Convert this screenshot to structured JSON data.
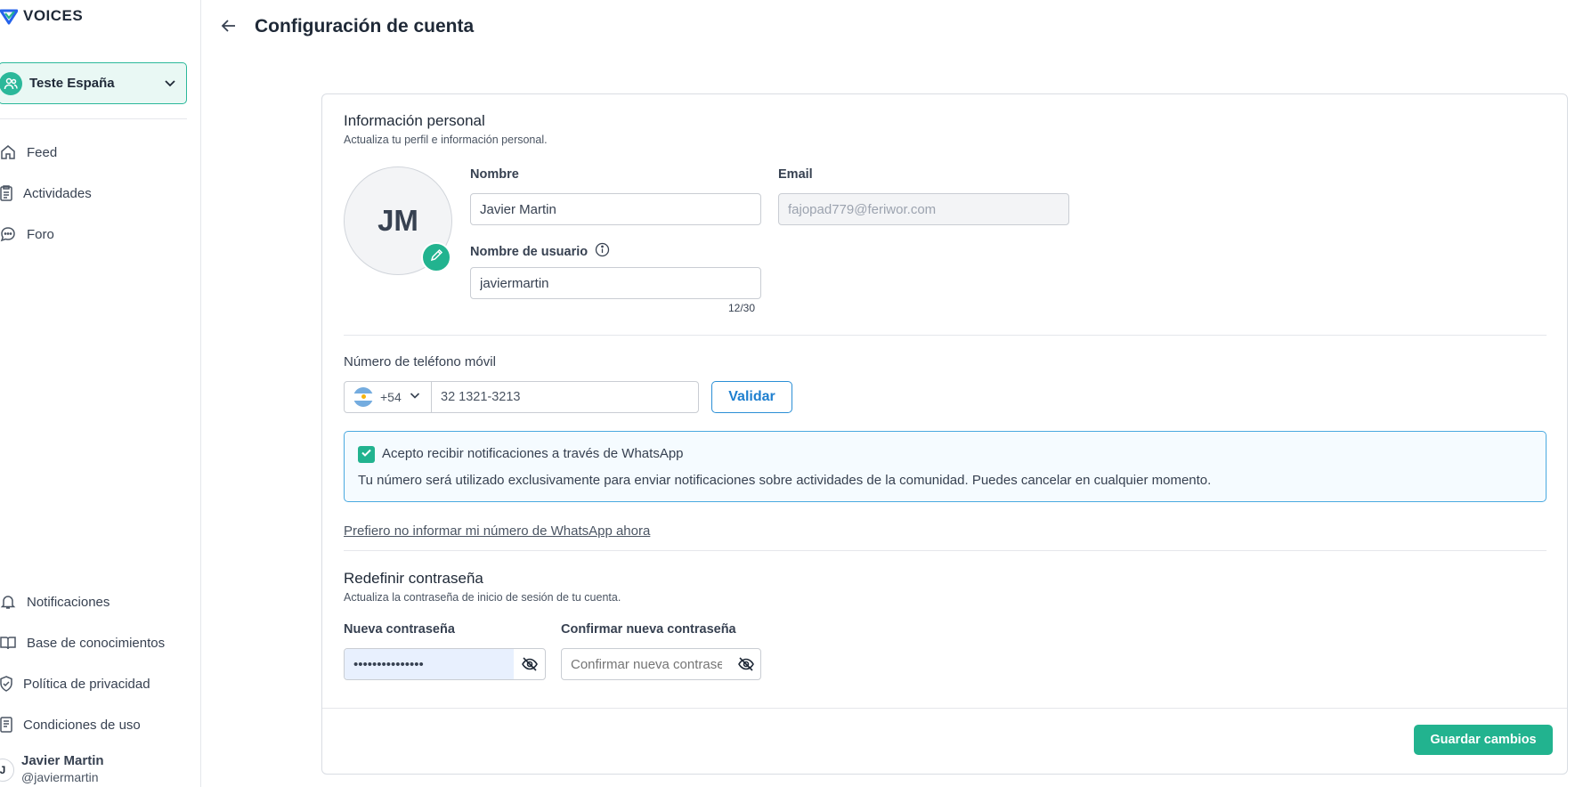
{
  "app": {
    "brand": "VOICES",
    "workspace": "Teste España"
  },
  "sidebar": {
    "nav_top": [
      {
        "label": "Feed",
        "icon": "home-icon"
      },
      {
        "label": "Actividades",
        "icon": "clipboard-icon"
      },
      {
        "label": "Foro",
        "icon": "chat-icon"
      }
    ],
    "nav_bottom": [
      {
        "label": "Notificaciones",
        "icon": "bell-icon"
      },
      {
        "label": "Base de conocimientos",
        "icon": "book-icon"
      },
      {
        "label": "Política de privacidad",
        "icon": "shield-check-icon"
      },
      {
        "label": "Condiciones de uso",
        "icon": "document-icon"
      }
    ],
    "user": {
      "initial": "J",
      "name": "Javier Martin",
      "handle": "@javiermartin"
    }
  },
  "header": {
    "title": "Configuración de cuenta"
  },
  "personal": {
    "title": "Información personal",
    "subtitle": "Actualiza tu perfil e información personal.",
    "avatar_initials": "JM",
    "name_label": "Nombre",
    "name_value": "Javier Martin",
    "email_label": "Email",
    "email_value": "fajopad779@feriwor.com",
    "username_label": "Nombre de usuario",
    "username_value": "javiermartin",
    "username_counter": "12/30"
  },
  "phone": {
    "label": "Número de teléfono móvil",
    "dial_code": "+54",
    "number": "32 1321-3213",
    "validate_label": "Validar",
    "whatsapp_consent": "Acepto recibir notificaciones a través de WhatsApp",
    "whatsapp_consent_checked": true,
    "whatsapp_note": "Tu número será utilizado exclusivamente para enviar notificaciones sobre actividades de la comunidad. Puedes cancelar en cualquier momento.",
    "skip_link": "Prefiero no informar mi número de WhatsApp ahora"
  },
  "password": {
    "title": "Redefinir contraseña",
    "subtitle": "Actualiza la contraseña de inicio de sesión de tu cuenta.",
    "new_label": "Nueva contraseña",
    "new_value": "•••••••••••••••",
    "confirm_label": "Confirmar nueva contraseña",
    "confirm_placeholder": "Confirmar nueva contraseña"
  },
  "footer": {
    "save_label": "Guardar cambios"
  },
  "colors": {
    "accent": "#22b38f",
    "link_blue": "#1e7fcf"
  }
}
